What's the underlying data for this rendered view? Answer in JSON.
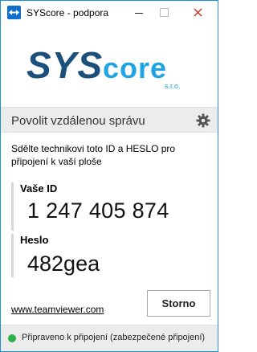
{
  "window": {
    "title": "SYScore - podpora",
    "close_color": "#c42b1c"
  },
  "logo": {
    "brand_sys": "SYS",
    "brand_core": "core",
    "brand_suffix": "s.r.o.",
    "colors": {
      "dark": "#1b4f7c",
      "light": "#1fa5e3"
    }
  },
  "header": {
    "title": "Povolit vzdálenou správu",
    "settings_icon": "gear-icon"
  },
  "main": {
    "instruction": "Sdělte technikovi toto ID a HESLO pro připojení k vaší ploše",
    "id_label": "Vaše ID",
    "id_value": "1 247 405 874",
    "password_label": "Heslo",
    "password_value": "482gea",
    "website_link": "www.teamviewer.com",
    "stop_button": "Storno"
  },
  "status": {
    "text": "Připraveno k připojení (zabezpečené připojení)",
    "color": "#2bb34a"
  }
}
